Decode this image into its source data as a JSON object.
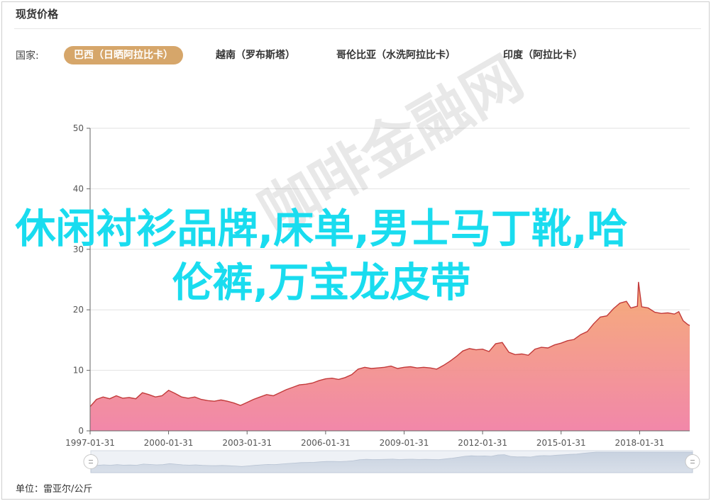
{
  "header": {
    "title": "现货价格"
  },
  "filter": {
    "label": "国家:",
    "countries": [
      {
        "label": "巴西（日晒阿拉比卡）",
        "active": true
      },
      {
        "label": "越南（罗布斯塔）",
        "active": false
      },
      {
        "label": "哥伦比亚（水洗阿拉比卡）",
        "active": false
      },
      {
        "label": "印度（阿拉比卡）",
        "active": false
      }
    ]
  },
  "overlay_text": "休闲衬衫品牌,床单,男士马丁靴,哈伦裤,万宝龙皮带",
  "watermark_text": "咖啡金融网",
  "unit_text": "单位：雷亚尔/公斤",
  "colors": {
    "accent": "#d6a66a",
    "line": "#c23a3a",
    "fill_top": "#f5a46a",
    "fill_bottom": "#f07aa0",
    "overlay": "#19dcef"
  },
  "chart_data": {
    "type": "area",
    "title": "",
    "xlabel": "",
    "ylabel": "",
    "ylim": [
      0,
      50
    ],
    "y_ticks": [
      0,
      10,
      20,
      30,
      40,
      50
    ],
    "x_ticks": [
      "1997-01-31",
      "2000-01-31",
      "2003-01-31",
      "2006-01-31",
      "2009-01-31",
      "2012-01-31",
      "2015-01-31",
      "2018-01-31"
    ],
    "x_range": [
      "1997-01-31",
      "2019-12-31"
    ],
    "grid": true,
    "series": [
      {
        "points": [
          [
            "1997-01-31",
            4.0
          ],
          [
            "1997-04-30",
            5.2
          ],
          [
            "1997-07-31",
            5.6
          ],
          [
            "1997-10-31",
            5.3
          ],
          [
            "1998-01-31",
            5.8
          ],
          [
            "1998-04-30",
            5.4
          ],
          [
            "1998-07-31",
            5.5
          ],
          [
            "1998-10-31",
            5.3
          ],
          [
            "1999-01-31",
            6.3
          ],
          [
            "1999-04-30",
            6.0
          ],
          [
            "1999-07-31",
            5.6
          ],
          [
            "1999-10-31",
            5.8
          ],
          [
            "2000-01-31",
            6.7
          ],
          [
            "2000-04-30",
            6.2
          ],
          [
            "2000-07-31",
            5.6
          ],
          [
            "2000-10-31",
            5.4
          ],
          [
            "2001-01-31",
            5.6
          ],
          [
            "2001-04-30",
            5.2
          ],
          [
            "2001-07-31",
            5.0
          ],
          [
            "2001-10-31",
            4.9
          ],
          [
            "2002-01-31",
            5.1
          ],
          [
            "2002-04-30",
            4.9
          ],
          [
            "2002-07-31",
            4.6
          ],
          [
            "2002-10-31",
            4.2
          ],
          [
            "2003-01-31",
            4.7
          ],
          [
            "2003-04-30",
            5.2
          ],
          [
            "2003-07-31",
            5.6
          ],
          [
            "2003-10-31",
            6.0
          ],
          [
            "2004-01-31",
            5.8
          ],
          [
            "2004-04-30",
            6.3
          ],
          [
            "2004-07-31",
            6.8
          ],
          [
            "2004-10-31",
            7.2
          ],
          [
            "2005-01-31",
            7.6
          ],
          [
            "2005-04-30",
            7.7
          ],
          [
            "2005-07-31",
            7.9
          ],
          [
            "2005-10-31",
            8.3
          ],
          [
            "2006-01-31",
            8.6
          ],
          [
            "2006-04-30",
            8.7
          ],
          [
            "2006-07-31",
            8.5
          ],
          [
            "2006-10-31",
            8.8
          ],
          [
            "2007-01-31",
            9.3
          ],
          [
            "2007-04-30",
            10.2
          ],
          [
            "2007-07-31",
            10.5
          ],
          [
            "2007-10-31",
            10.3
          ],
          [
            "2008-01-31",
            10.4
          ],
          [
            "2008-04-30",
            10.5
          ],
          [
            "2008-07-31",
            10.7
          ],
          [
            "2008-10-31",
            10.3
          ],
          [
            "2009-01-31",
            10.5
          ],
          [
            "2009-04-30",
            10.6
          ],
          [
            "2009-07-31",
            10.4
          ],
          [
            "2009-10-31",
            10.5
          ],
          [
            "2010-01-31",
            10.4
          ],
          [
            "2010-04-30",
            10.2
          ],
          [
            "2010-07-31",
            10.8
          ],
          [
            "2010-10-31",
            11.5
          ],
          [
            "2011-01-31",
            12.3
          ],
          [
            "2011-04-30",
            13.2
          ],
          [
            "2011-07-31",
            13.6
          ],
          [
            "2011-10-31",
            13.4
          ],
          [
            "2012-01-31",
            13.5
          ],
          [
            "2012-04-30",
            13.1
          ],
          [
            "2012-07-31",
            14.4
          ],
          [
            "2012-10-31",
            14.6
          ],
          [
            "2013-01-31",
            13.0
          ],
          [
            "2013-04-30",
            12.6
          ],
          [
            "2013-07-31",
            12.7
          ],
          [
            "2013-10-31",
            12.5
          ],
          [
            "2014-01-31",
            13.5
          ],
          [
            "2014-04-30",
            13.8
          ],
          [
            "2014-07-31",
            13.7
          ],
          [
            "2014-10-31",
            14.2
          ],
          [
            "2015-01-31",
            14.5
          ],
          [
            "2015-04-30",
            14.9
          ],
          [
            "2015-07-31",
            15.1
          ],
          [
            "2015-10-31",
            15.9
          ],
          [
            "2016-01-31",
            16.4
          ],
          [
            "2016-04-30",
            17.7
          ],
          [
            "2016-07-31",
            18.8
          ],
          [
            "2016-10-31",
            19.0
          ],
          [
            "2017-01-31",
            20.2
          ],
          [
            "2017-04-30",
            21.1
          ],
          [
            "2017-07-31",
            21.4
          ],
          [
            "2017-09-30",
            20.3
          ],
          [
            "2017-12-31",
            20.6
          ],
          [
            "2018-01-15",
            24.6
          ],
          [
            "2018-02-28",
            20.5
          ],
          [
            "2018-05-31",
            20.3
          ],
          [
            "2018-08-31",
            19.6
          ],
          [
            "2018-11-30",
            19.4
          ],
          [
            "2019-02-28",
            19.5
          ],
          [
            "2019-05-31",
            19.3
          ],
          [
            "2019-07-31",
            19.7
          ],
          [
            "2019-09-30",
            18.2
          ],
          [
            "2019-11-30",
            17.6
          ],
          [
            "2019-12-31",
            17.4
          ]
        ]
      }
    ]
  }
}
